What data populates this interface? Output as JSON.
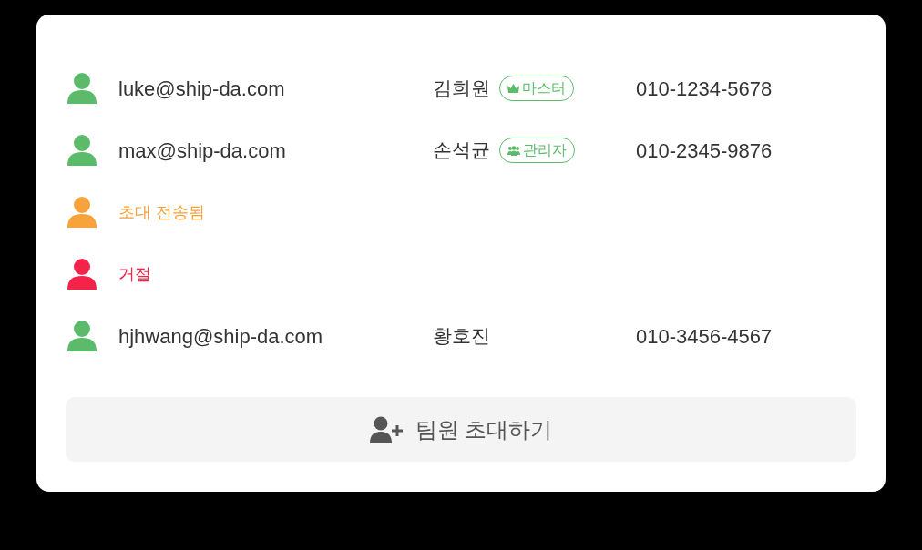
{
  "members": [
    {
      "kind": "member",
      "color": "#5cbb6a",
      "email": "luke@ship-da.com",
      "name": "김희원",
      "role": {
        "kind": "master",
        "label": "마스터"
      },
      "phone": "010-1234-5678"
    },
    {
      "kind": "member",
      "color": "#5cbb6a",
      "email": "max@ship-da.com",
      "name": "손석균",
      "role": {
        "kind": "admin",
        "label": "관리자"
      },
      "phone": "010-2345-9876"
    },
    {
      "kind": "status",
      "color": "#f7a23b",
      "status": "초대 전송됨"
    },
    {
      "kind": "status",
      "color": "#f5224a",
      "status": "거절"
    },
    {
      "kind": "member",
      "color": "#5cbb6a",
      "email": "hjhwang@ship-da.com",
      "name": "황호진",
      "phone": "010-3456-4567"
    }
  ],
  "invite_button": {
    "label": "팀원 초대하기"
  }
}
